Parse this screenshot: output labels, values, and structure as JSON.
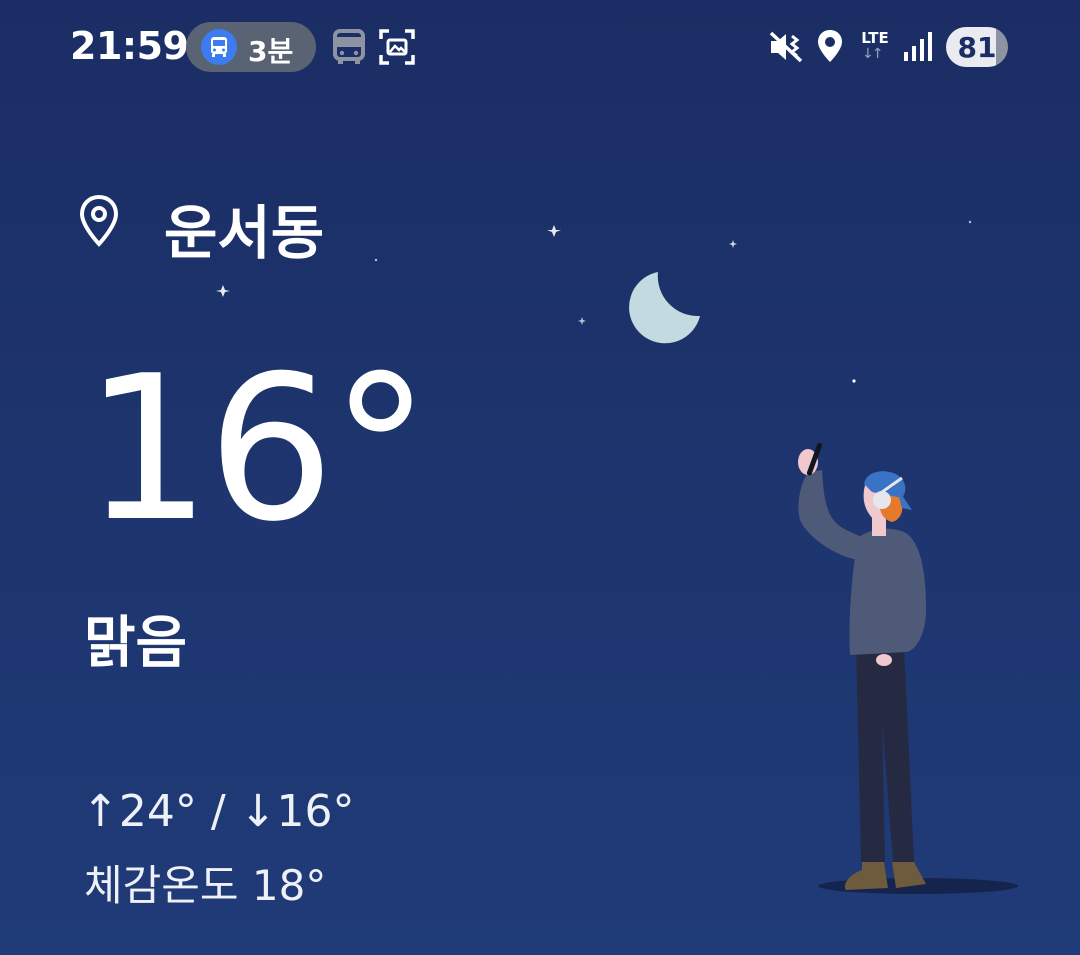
{
  "status_bar": {
    "time": "21:59",
    "bus_pill_label": "3분",
    "network_type": "LTE",
    "network_arrows": "↓↑",
    "battery_level": "81",
    "icons": [
      "bus-icon",
      "bus-outline-icon",
      "screenshot-scan-icon",
      "vibrate-mute-icon",
      "location-icon",
      "signal-icon",
      "battery-icon"
    ]
  },
  "weather": {
    "location": "운서동",
    "temperature": "16°",
    "condition": "맑음",
    "high_low": "↑24° / ↓16°",
    "feels_like": "체감온도 18°"
  },
  "colors": {
    "background_top": "#1b2d64",
    "background_bottom": "#1f3b78",
    "moon": "#c3dae0",
    "bus_accent": "#3d7bf0"
  }
}
